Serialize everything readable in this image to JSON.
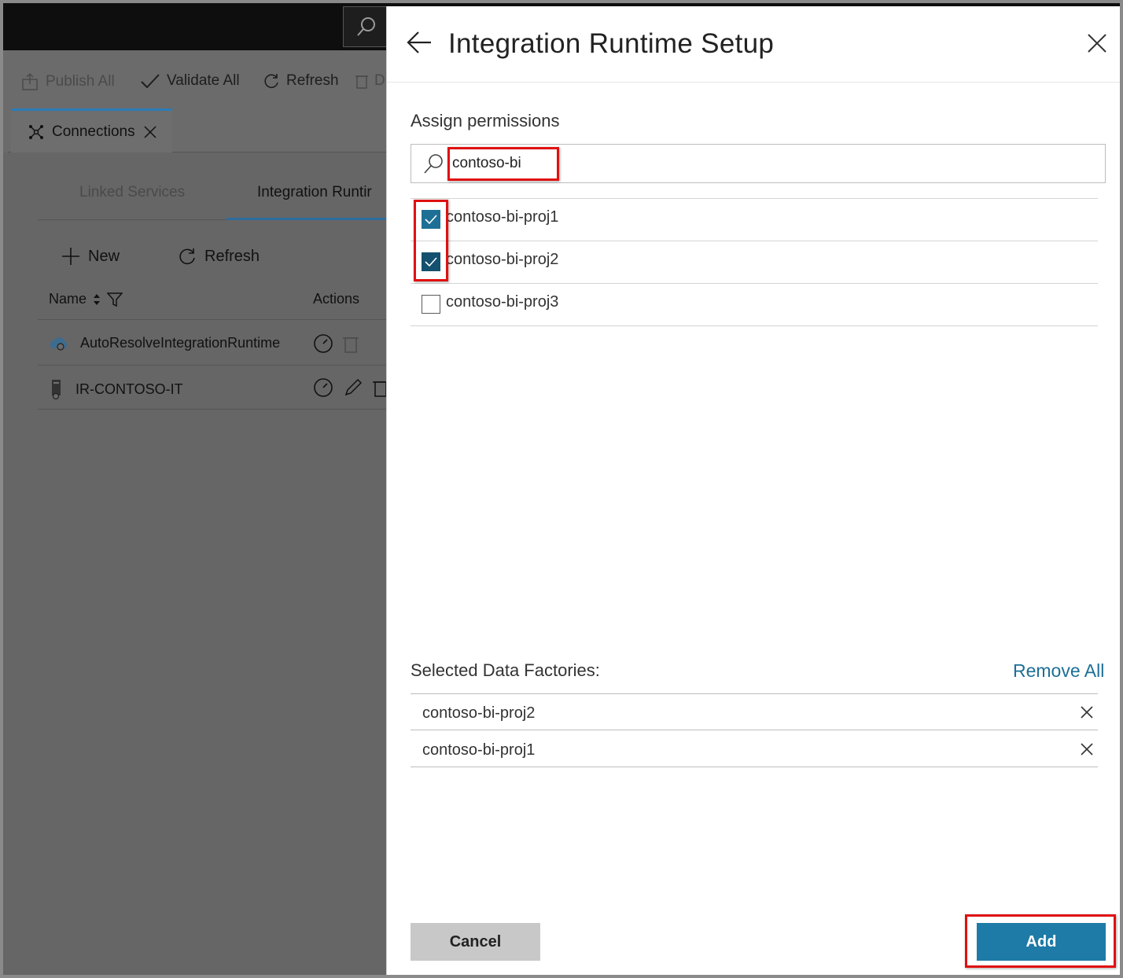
{
  "background": {
    "toolbar": {
      "publish_all": "Publish All",
      "validate_all": "Validate All",
      "refresh": "Refresh",
      "truncated": "D"
    },
    "tab": {
      "label": "Connections"
    },
    "subtabs": [
      "Linked Services",
      "Integration Runtir"
    ],
    "actions": {
      "new": "New",
      "refresh": "Refresh"
    },
    "columns": {
      "name": "Name",
      "actions": "Actions"
    },
    "rows": [
      "AutoResolveIntegrationRuntime",
      "IR-CONTOSO-IT"
    ]
  },
  "panel": {
    "title": "Integration Runtime Setup",
    "assign_label": "Assign permissions",
    "search": {
      "value": "contoso-bi"
    },
    "results": [
      {
        "label": "contoso-bi-proj1",
        "checked": true
      },
      {
        "label": "contoso-bi-proj2",
        "checked": true
      },
      {
        "label": "contoso-bi-proj3",
        "checked": false
      }
    ],
    "selected_label": "Selected Data Factories:",
    "remove_all": "Remove All",
    "selected": [
      "contoso-bi-proj2",
      "contoso-bi-proj1"
    ],
    "cancel": "Cancel",
    "add": "Add"
  },
  "colors": {
    "accent": "#1e7aa6",
    "highlight": "#e01010",
    "overlay": "#6b6b6b"
  }
}
